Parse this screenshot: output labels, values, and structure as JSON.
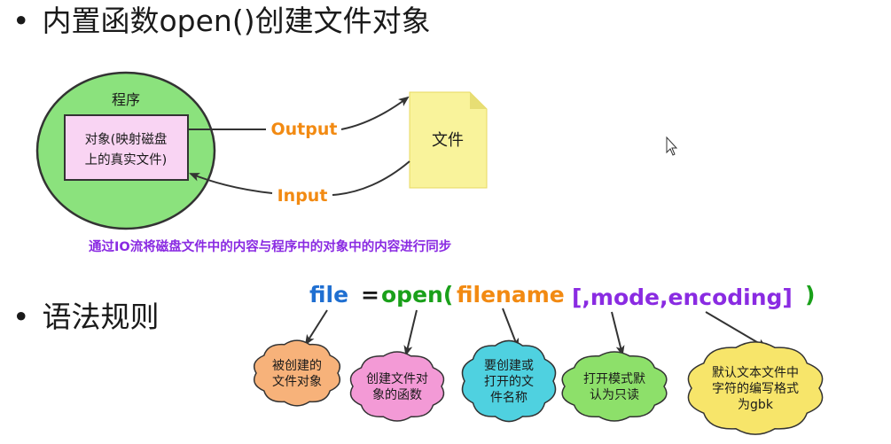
{
  "headings": {
    "bullet": "•",
    "section1": "内置函数open()创建文件对象",
    "section2": "语法规则"
  },
  "diagram": {
    "program_label": "程序",
    "object_line1": "对象(映射磁盘",
    "object_line2": "上的真实文件)",
    "file_label": "文件",
    "output_label": "Output",
    "input_label": "Input",
    "sync_note": "通过IO流将磁盘文件中的内容与程序中的对象中的内容进行同步"
  },
  "syntax": {
    "file": "file",
    "equals": "=",
    "open": "open(",
    "filename": "filename",
    "optional": "[,mode,encoding]",
    "close": ")",
    "colors": {
      "file": "#1f6fd1",
      "equals": "#1a1a1a",
      "open": "#1aa01a",
      "filename": "#f28a12",
      "optional": "#8a2be2",
      "close": "#1aa01a"
    }
  },
  "callouts": [
    {
      "lines": [
        "被创建的",
        "文件对象"
      ],
      "color": "#f7b27a"
    },
    {
      "lines": [
        "创建文件对",
        "象的函数"
      ],
      "color": "#f39ad6"
    },
    {
      "lines": [
        "要创建或",
        "打开的文",
        "件名称"
      ],
      "color": "#4fd1e0"
    },
    {
      "lines": [
        "打开模式默",
        "认为只读"
      ],
      "color": "#8de06a"
    },
    {
      "lines": [
        "默认文本文件中",
        "字符的编写格式",
        "为gbk"
      ],
      "color": "#f7e56a"
    }
  ],
  "colors": {
    "program_fill": "#8be27d",
    "object_fill": "#f9d4f3",
    "file_fill": "#f9f39b",
    "arrow": "#333333"
  }
}
